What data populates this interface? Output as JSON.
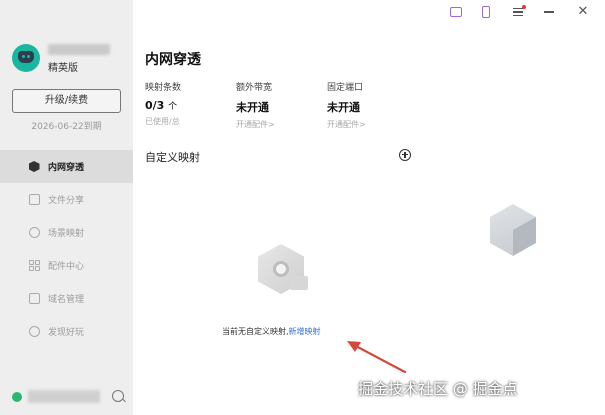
{
  "sidebar": {
    "edition": "精英版",
    "upgrade_label": "升级/续费",
    "expiry": "2026-06-22到期",
    "items": [
      {
        "label": "内网穿透",
        "icon": "cube-icon"
      },
      {
        "label": "文件分享",
        "icon": "folder-icon"
      },
      {
        "label": "场景映射",
        "icon": "target-icon"
      },
      {
        "label": "配件中心",
        "icon": "grid-icon"
      },
      {
        "label": "域名管理",
        "icon": "domain-icon"
      },
      {
        "label": "发现好玩",
        "icon": "compass-icon"
      }
    ]
  },
  "main": {
    "title": "内网穿透",
    "stats": [
      {
        "label": "映射条数",
        "value": "0/3",
        "unit": "个",
        "sub": "已使用/总"
      },
      {
        "label": "额外带宽",
        "value": "未开通",
        "unit": "",
        "sub": "开通配件>"
      },
      {
        "label": "固定端口",
        "value": "未开通",
        "unit": "",
        "sub": "开通配件>"
      }
    ],
    "section_title": "自定义映射",
    "empty_text": "当前无自定义映射,",
    "empty_link": "新增映射"
  },
  "watermark": "掘金技术社区 @ 掘金点",
  "colors": {
    "sidebar_bg": "#eeeeee",
    "active_item_bg": "#dcdcdc",
    "link": "#2f6fd6",
    "annotation_arrow": "#d9473a",
    "brand_logo": "#19b7a0"
  }
}
